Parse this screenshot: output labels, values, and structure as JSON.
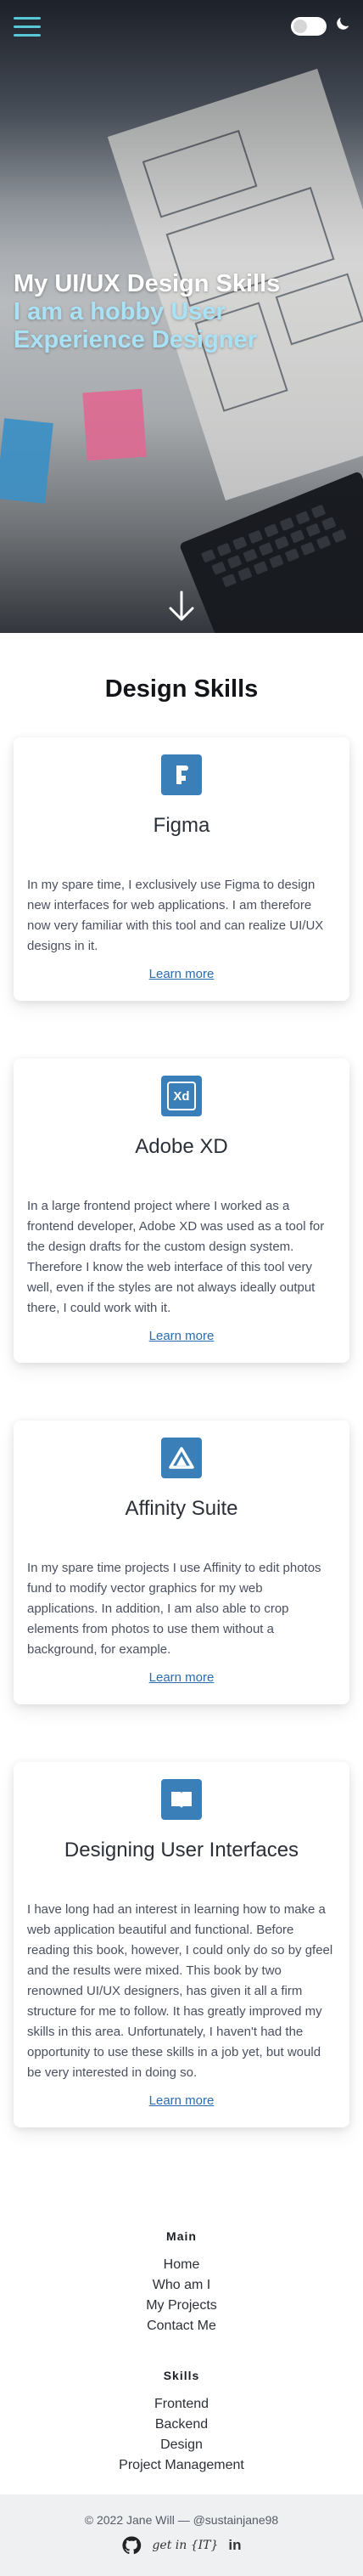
{
  "header": {
    "menu_icon": "hamburger-icon",
    "theme_toggle_icon": "toggle-icon",
    "theme_icon": "moon-icon"
  },
  "hero": {
    "title": "My UI/UX Design Skills",
    "subtitle": "I am a hobby User Experience Designer",
    "scroll_icon": "arrow-down-icon"
  },
  "skills": {
    "title": "Design Skills",
    "cards": [
      {
        "icon": "figma-icon",
        "title": "Figma",
        "text": "In my spare time, I exclusively use Figma to design new interfaces for web applications. I am therefore now very familiar with this tool and can realize UI/UX designs in it.",
        "link": "Learn more"
      },
      {
        "icon": "adobe-xd-icon",
        "icon_text": "Xd",
        "title": "Adobe XD",
        "text": "In a large frontend project where I worked as a frontend developer, Adobe XD was used as a tool for the design drafts for the custom design system. Therefore I know the web interface of this tool very well, even if the styles are not always ideally output there, I could work with it.",
        "link": "Learn more"
      },
      {
        "icon": "affinity-icon",
        "title": "Affinity Suite",
        "text": "In my spare time projects I use Affinity to edit photos fund to modify vector graphics for my web applications. In addition, I am also able to crop elements from photos to use them without a background, for example.",
        "link": "Learn more"
      },
      {
        "icon": "book-icon",
        "title": "Designing User Interfaces",
        "text": "I have long had an interest in learning how to make a web application beautiful and functional. Before reading this book, however, I could only do so by gfeel and the results were mixed. This book by two renowned UI/UX designers, has given it all a firm structure for me to follow. It has greatly improved my skills in this area. Unfortunately, I haven't had the opportunity to use these skills in a job yet, but would be very interested in doing so.",
        "link": "Learn more"
      }
    ]
  },
  "footer": {
    "main": {
      "heading": "Main",
      "links": [
        "Home",
        "Who am I",
        "My Projects",
        "Contact Me"
      ]
    },
    "skills": {
      "heading": "Skills",
      "links": [
        "Frontend",
        "Backend",
        "Design",
        "Project Management"
      ]
    },
    "copyright": "© 2022 Jane Will — @sustainjane98",
    "social": {
      "github_icon": "github-icon",
      "getin_label": "get in {IT}",
      "linkedin_label": "in"
    }
  },
  "colors": {
    "accent_blue": "#3a7fb8",
    "link_blue": "#2b6cb0",
    "hero_subtitle": "#a9e2f5",
    "menu_cyan": "#58c7d8"
  }
}
